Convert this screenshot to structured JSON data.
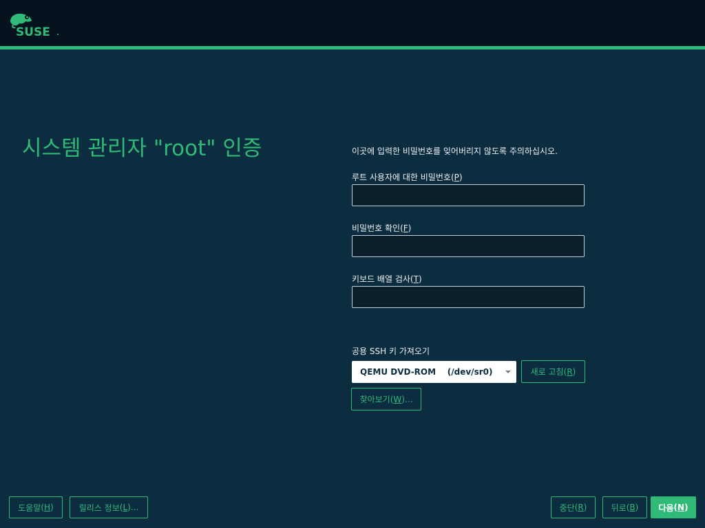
{
  "header": {
    "logo_text": "SUSE",
    "accent_color": "#30ba78"
  },
  "page": {
    "title": "시스템 관리자 \"root\" 인증",
    "notice": "이곳에 입력한 비밀번호를 잊어버리지 않도록 주의하십시오."
  },
  "form": {
    "password": {
      "label": "루트 사용자에 대한 비밀번호",
      "mnemonic": "P",
      "value": ""
    },
    "confirm": {
      "label": "비밀번호 확인",
      "mnemonic": "F",
      "value": ""
    },
    "keyboard_test": {
      "label": "키보드 배열 검사",
      "mnemonic": "T",
      "value": ""
    },
    "ssh_import": {
      "label": "공용 SSH 키 가져오기",
      "selected_device": "QEMU DVD-ROM    (/dev/sr0)",
      "refresh_label": "새로 고침",
      "refresh_mnemonic": "R",
      "browse_label": "찾아보기",
      "browse_mnemonic": "W",
      "browse_suffix": "..."
    }
  },
  "footer": {
    "help": {
      "label": "도움말",
      "mnemonic": "H"
    },
    "release_notes": {
      "label": "릴리스 정보",
      "mnemonic": "L",
      "suffix": "..."
    },
    "abort": {
      "label": "중단",
      "mnemonic": "R"
    },
    "back": {
      "label": "뒤로",
      "mnemonic": "B"
    },
    "next": {
      "label": "다음",
      "mnemonic": "N"
    }
  }
}
